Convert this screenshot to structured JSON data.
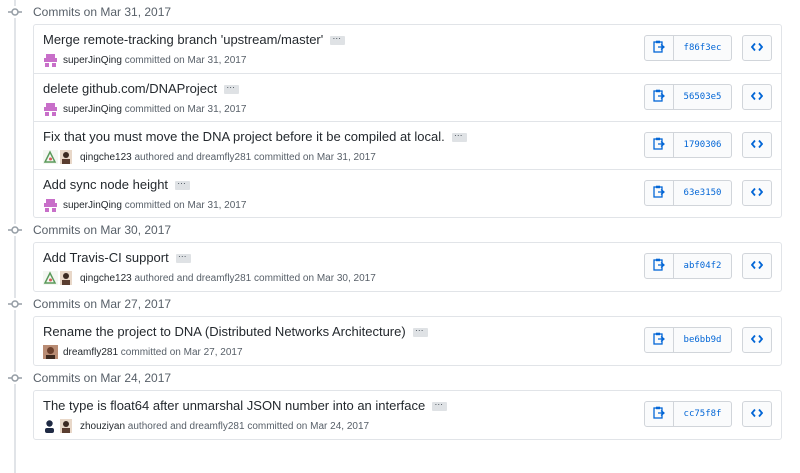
{
  "groups": [
    {
      "header": "Commits on Mar 31, 2017",
      "commits": [
        {
          "title": "Merge remote-tracking branch 'upstream/master'",
          "author": "superJinQing",
          "meta": " committed on Mar 31, 2017",
          "sha": "f86f3ec",
          "avatars": [
            "pink"
          ]
        },
        {
          "title": "delete github.com/DNAProject",
          "author": "superJinQing",
          "meta": " committed on Mar 31, 2017",
          "sha": "56503e5",
          "avatars": [
            "pink"
          ]
        },
        {
          "title": "Fix that you must move the DNA project before it be compiled at local.",
          "author": "qingche123",
          "meta": " authored and dreamfly281 committed on Mar 31, 2017",
          "sha": "1790306",
          "avatars": [
            "green",
            "person"
          ]
        },
        {
          "title": "Add sync node height",
          "author": "superJinQing",
          "meta": " committed on Mar 31, 2017",
          "sha": "63e3150",
          "avatars": [
            "pink"
          ]
        }
      ]
    },
    {
      "header": "Commits on Mar 30, 2017",
      "commits": [
        {
          "title": "Add Travis-CI support",
          "author": "qingche123",
          "meta": " authored and dreamfly281 committed on Mar 30, 2017",
          "sha": "abf04f2",
          "avatars": [
            "green",
            "person"
          ]
        }
      ]
    },
    {
      "header": "Commits on Mar 27, 2017",
      "commits": [
        {
          "title": "Rename the project to DNA (Distributed Networks Architecture)",
          "author": "dreamfly281",
          "meta": " committed on Mar 27, 2017",
          "sha": "be6bb9d",
          "avatars": [
            "photo"
          ]
        }
      ]
    },
    {
      "header": "Commits on Mar 24, 2017",
      "commits": [
        {
          "title": "The type is float64 after unmarshal JSON number into an interface",
          "author": "zhouziyan",
          "meta": " authored and dreamfly281 committed on Mar 24, 2017",
          "sha": "cc75f8f",
          "avatars": [
            "dark",
            "person"
          ]
        }
      ]
    }
  ],
  "colors": {
    "link": "#0366d6",
    "muted": "#586069",
    "border": "#e1e4e8",
    "pink_avatar": "#c86fc9"
  },
  "icons": {
    "timeline_node": "git-commit-icon",
    "copy": "clipboard-icon",
    "browse": "code-icon"
  }
}
